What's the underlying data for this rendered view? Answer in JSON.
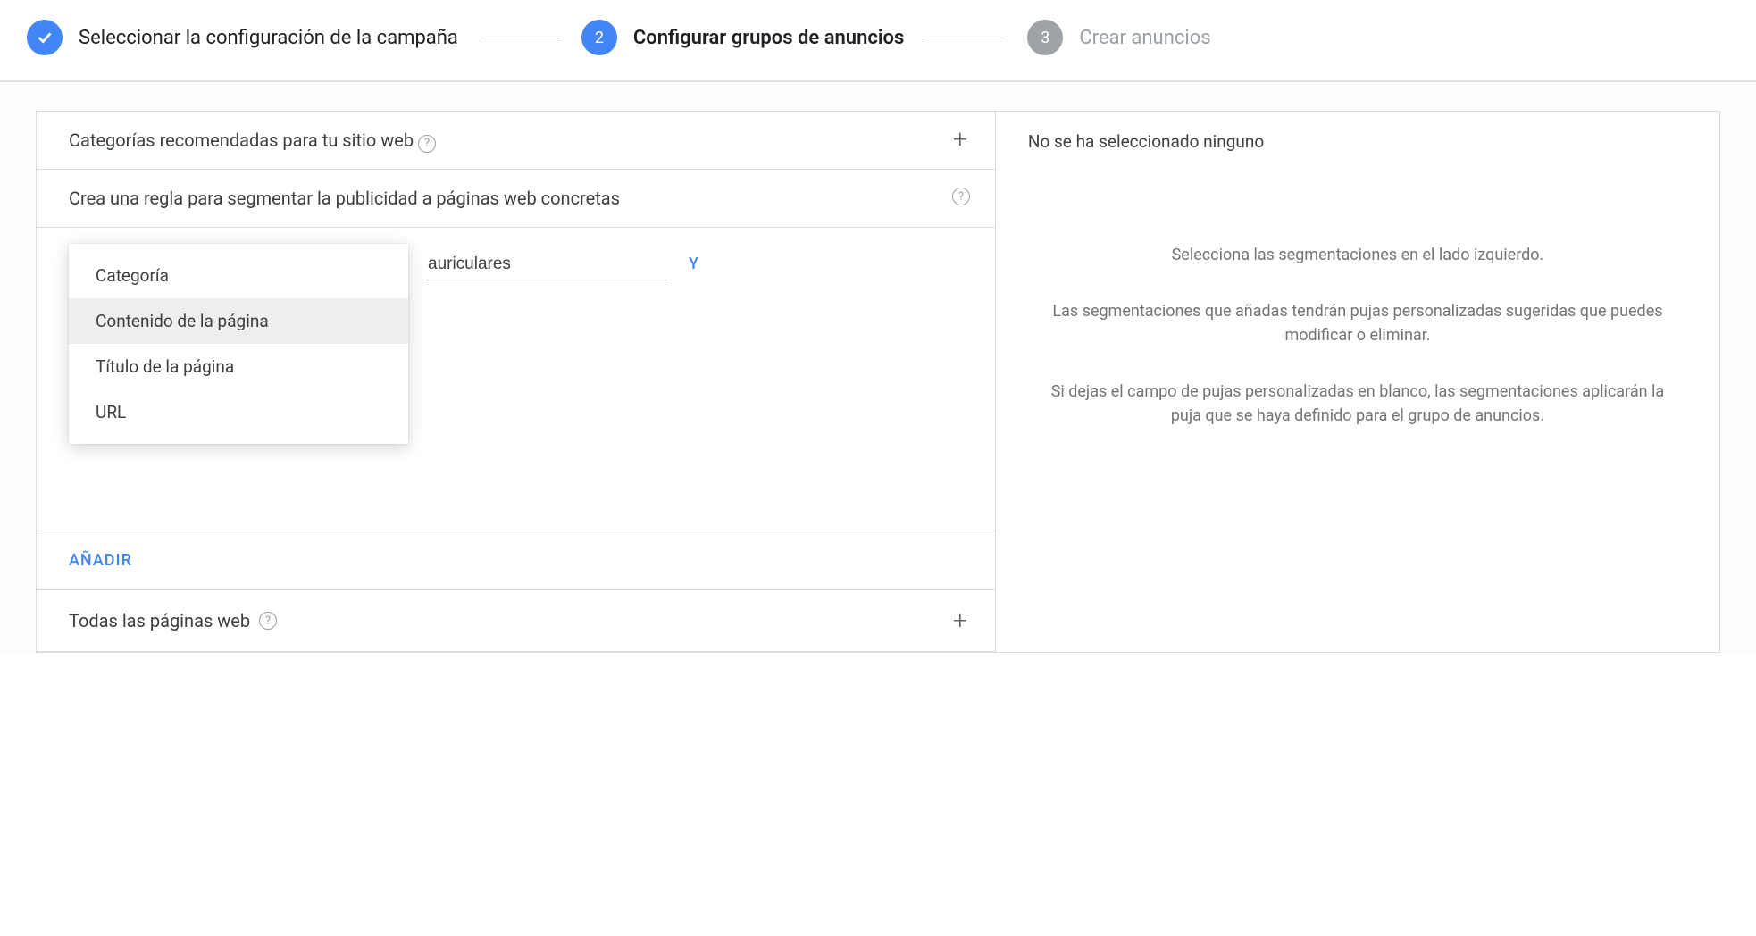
{
  "stepper": {
    "step1_label": "Seleccionar la configuración de la campaña",
    "step2_num": "2",
    "step2_label": "Configurar grupos de anuncios",
    "step3_num": "3",
    "step3_label": "Crear anuncios"
  },
  "left": {
    "recommended_title": "Categorías recomendadas para tu sitio web",
    "create_rule_title": "Crea una regla para segmentar la publicidad a páginas web concretas",
    "rule_input_value": "auriculares",
    "and_label": "Y",
    "dropdown": {
      "items": [
        {
          "label": "Categoría"
        },
        {
          "label": "Contenido de la página",
          "selected": true
        },
        {
          "label": "Título de la página"
        },
        {
          "label": "URL"
        }
      ]
    },
    "add_label": "AÑADIR",
    "all_pages_label": "Todas las páginas web"
  },
  "right": {
    "header": "No se ha seleccionado ninguno",
    "p1": "Selecciona las segmentaciones en el lado izquierdo.",
    "p2": "Las segmentaciones que añadas tendrán pujas personalizadas sugeridas que puedes modificar o eliminar.",
    "p3": "Si dejas el campo de pujas personalizadas en blanco, las segmentaciones aplicarán la puja que se haya definido para el grupo de anuncios."
  }
}
